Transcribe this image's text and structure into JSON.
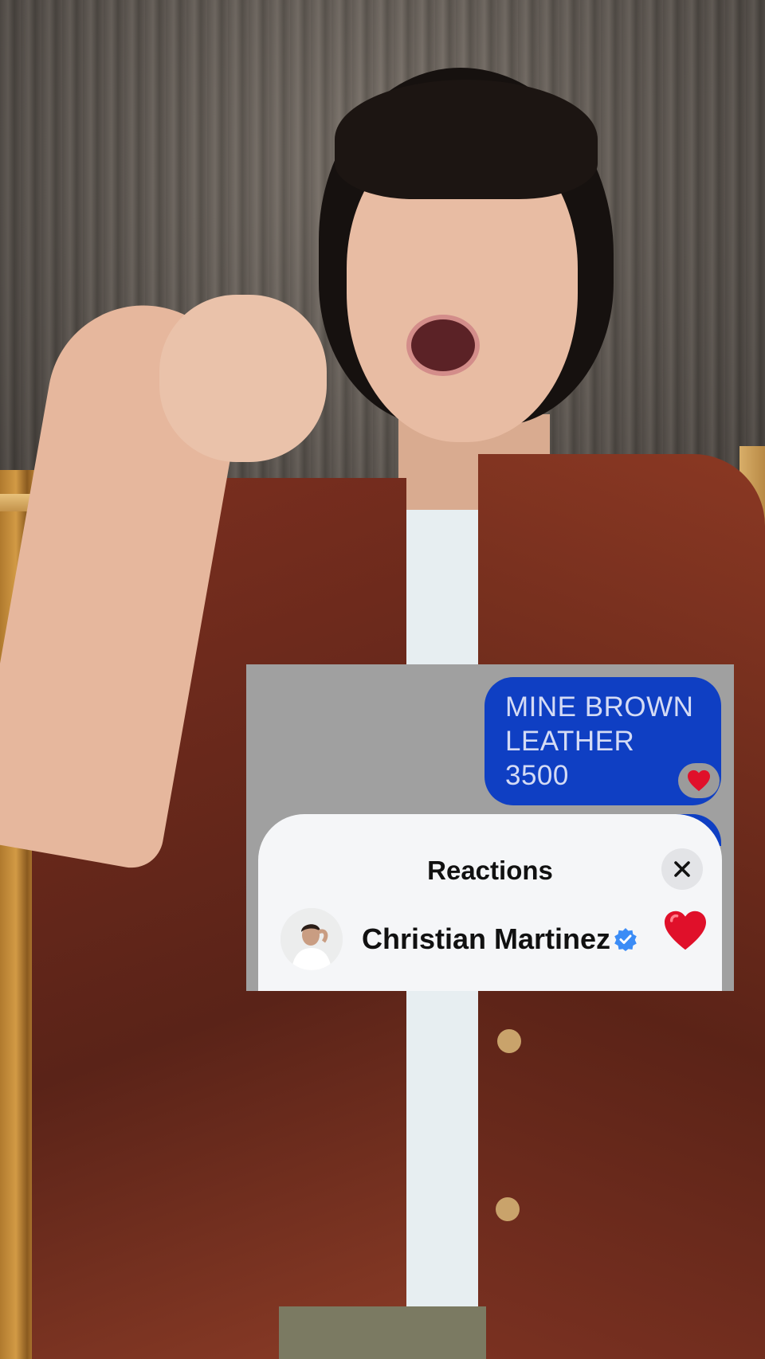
{
  "chat": {
    "sent_message": "MINE BROWN\nLEATHER 3500",
    "sent_message_reaction": "❤️",
    "bubble_color": "#0f3fc3",
    "panel_color": "#a0a0a0"
  },
  "reactions_sheet": {
    "title": "Reactions",
    "close_icon": "close-icon",
    "items": [
      {
        "user_name": "Christian Martinez",
        "verified": true,
        "reaction": "heart"
      }
    ]
  }
}
